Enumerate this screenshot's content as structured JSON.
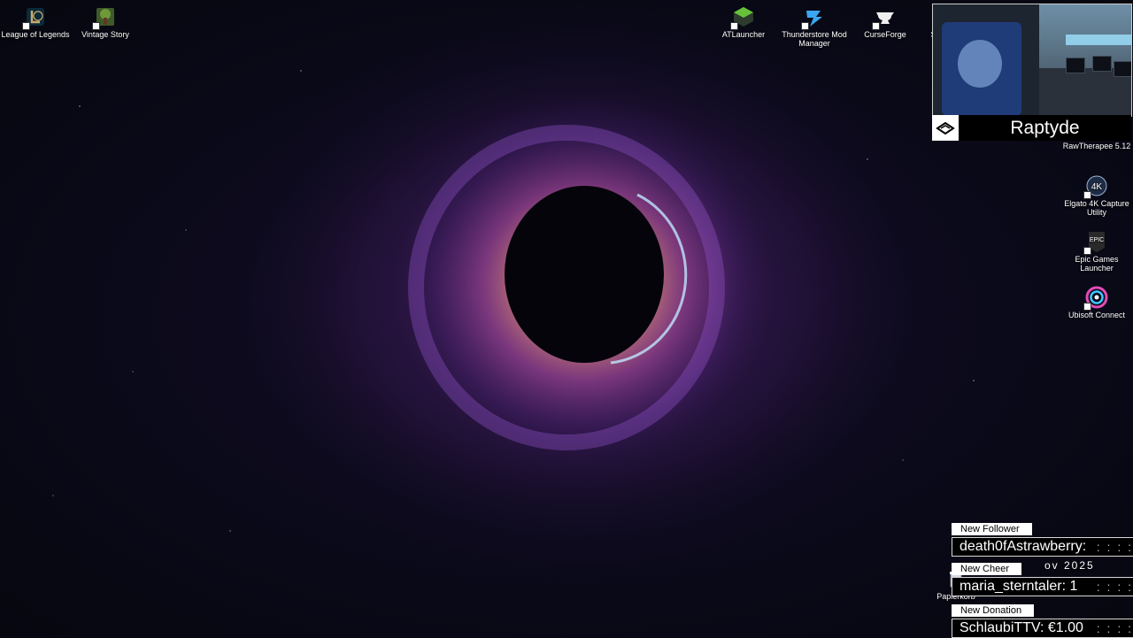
{
  "desktop_icons_left": [
    {
      "label": "League of Legends",
      "icon": "league-of-legends-icon"
    },
    {
      "label": "Vintage Story",
      "icon": "vintage-story-icon"
    }
  ],
  "desktop_icons_top_right": [
    {
      "label": "ATLauncher",
      "icon": "atlauncher-icon"
    },
    {
      "label": "Thunderstore Mod Manager",
      "icon": "thunderstore-icon"
    },
    {
      "label": "CurseForge",
      "icon": "curseforge-icon"
    },
    {
      "label": "St",
      "icon": "partial-icon"
    }
  ],
  "desktop_icons_right": [
    {
      "label": "RawTherapee 5.12",
      "icon": "rawtherapee-icon"
    },
    {
      "label": "Elgato 4K Capture Utility",
      "icon": "elgato-4k-icon"
    },
    {
      "label": "Epic Games Launcher",
      "icon": "epic-games-icon"
    },
    {
      "label": "Ubisoft Connect",
      "icon": "ubisoft-connect-icon"
    }
  ],
  "recycle_bin": {
    "label": "Papierkorb"
  },
  "stream_overlay": {
    "streamer_name": "Raptyde",
    "alerts": [
      {
        "tag": "New Follower",
        "text": "death0fAstrawberry:"
      },
      {
        "tag": "New Cheer",
        "text": "maria_sterntaler: 1"
      },
      {
        "tag": "New Donation",
        "text": "SchlaubiTTV: €1.00"
      }
    ],
    "date_fragment": "ov 2025"
  }
}
